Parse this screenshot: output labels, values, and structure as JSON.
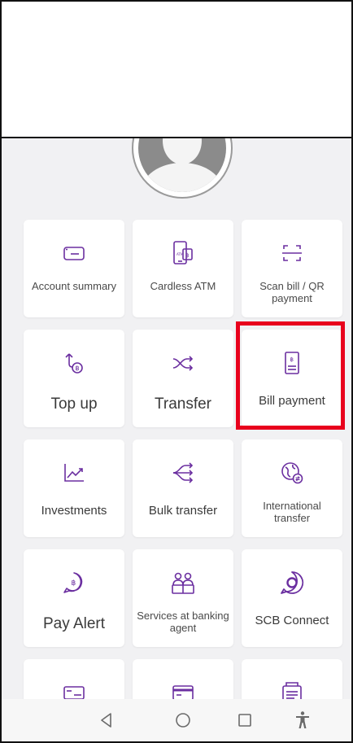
{
  "colors": {
    "accent": "#6b2fa0",
    "highlight": "#e8001c",
    "tile_bg": "#ffffff",
    "page_bg": "#f1f1f3"
  },
  "menu": {
    "tiles": [
      {
        "label": "Account summary",
        "icon": "card-icon"
      },
      {
        "label": "Cardless ATM",
        "icon": "phone-atm-icon"
      },
      {
        "label": "Scan bill / QR payment",
        "icon": "scan-icon"
      },
      {
        "label": "Top up",
        "icon": "baht-up-icon"
      },
      {
        "label": "Transfer",
        "icon": "shuffle-icon"
      },
      {
        "label": "Bill payment",
        "icon": "bill-icon"
      },
      {
        "label": "Investments",
        "icon": "chart-icon"
      },
      {
        "label": "Bulk transfer",
        "icon": "bulk-transfer-icon"
      },
      {
        "label": "International transfer",
        "icon": "globe-transfer-icon"
      },
      {
        "label": "Pay Alert",
        "icon": "baht-bubble-icon"
      },
      {
        "label": "Services at banking agent",
        "icon": "agent-icon"
      },
      {
        "label": "SCB Connect",
        "icon": "connect-icon"
      }
    ],
    "partial_icons": [
      "card-outline-icon",
      "credit-card-icon",
      "printer-icon"
    ]
  },
  "navbar": {
    "back": "back-triangle-icon",
    "home": "home-circle-icon",
    "recents": "recents-square-icon",
    "accessibility": "accessibility-icon"
  }
}
